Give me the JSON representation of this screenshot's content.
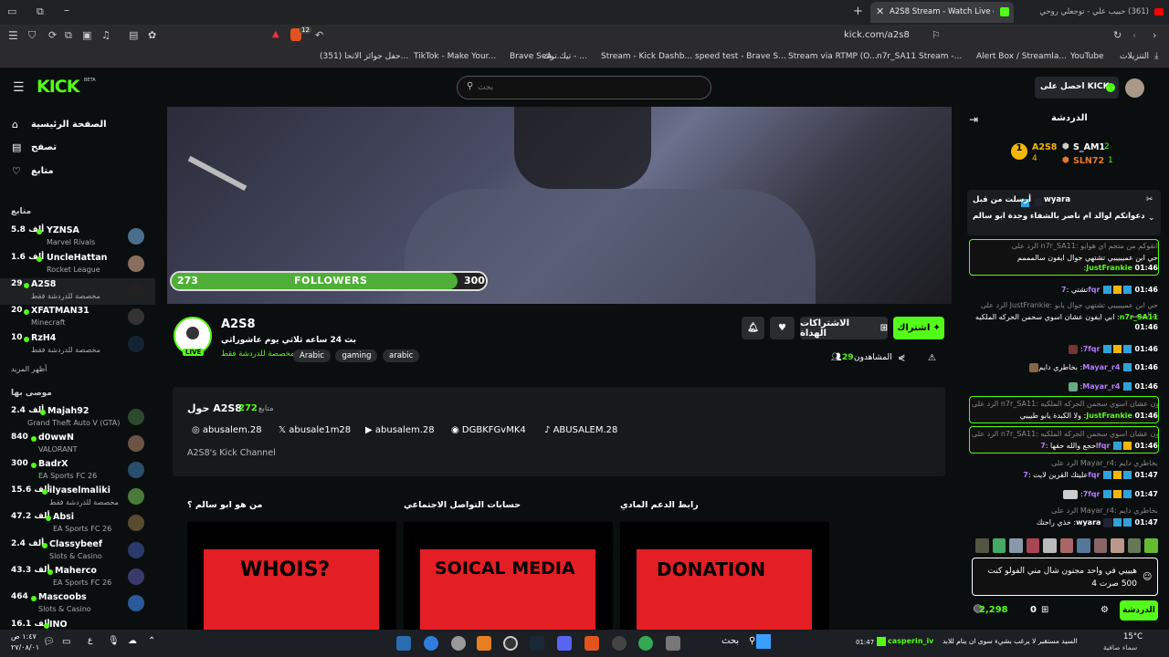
{
  "browser": {
    "tabs": [
      {
        "label": "A2S8 Stream - Watch Live on"
      },
      {
        "label": "(361) حبيب علي - توجعلي روحي"
      }
    ],
    "url": "kick.com/a2s8",
    "shield_count": "12",
    "bookmarks": [
      "التنزيلات",
      "YouTube",
      "Alert Box / Streamla...",
      "n7r_SA11 Stream -...",
      "Stream via RTMP (O...",
      "speed test - Brave S...",
      "Stream - Kick Dashb...",
      "تيك توك - ...",
      "Brave Sea...",
      "TikTok - Make Your...",
      "(351) حفل جوائز الاتحا..."
    ]
  },
  "header": {
    "logo": "KICK",
    "beta": "BETA",
    "search_placeholder": "بحث",
    "get_kicks_label": "احصل على KICKs"
  },
  "sidebar": {
    "nav": [
      {
        "label": "الصفحة الرئيسية",
        "icon": "home-icon"
      },
      {
        "label": "تصفح",
        "icon": "browse-icon"
      },
      {
        "label": "متابع",
        "icon": "heart-icon"
      }
    ],
    "following_title": "متابع",
    "following": [
      {
        "name": "YZNSA",
        "viewers": "5.8 ألف",
        "game": "Marvel Rivals"
      },
      {
        "name": "UncleHattan",
        "viewers": "1.6 ألف",
        "game": "Rocket League"
      },
      {
        "name": "A2S8",
        "viewers": "29",
        "game": "مخصصة للدردشة فقط"
      },
      {
        "name": "XFATMAN31",
        "viewers": "20",
        "game": "Minecraft"
      },
      {
        "name": "RzH4",
        "viewers": "10",
        "game": "مخصصة للدردشة فقط"
      }
    ],
    "show_more": "أظهر المزيد",
    "recommended_title": "موصى بها",
    "recommended": [
      {
        "name": "Majah92",
        "viewers": "2.4 ألف",
        "game": "Grand Theft Auto V (GTA)"
      },
      {
        "name": "d0wwN",
        "viewers": "840",
        "game": "VALORANT"
      },
      {
        "name": "BadrX",
        "viewers": "300",
        "game": "EA Sports FC 26"
      },
      {
        "name": "ilyaselmaliki",
        "viewers": "15.6 ألف",
        "game": "مخصصة للدردشة فقط"
      },
      {
        "name": "Absi",
        "viewers": "47.2 ألف",
        "game": "EA Sports FC 26"
      },
      {
        "name": "Classybeef",
        "viewers": "2.4 ألف",
        "game": "Slots & Casino"
      },
      {
        "name": "Maherco",
        "viewers": "43.3 ألف",
        "game": "EA Sports FC 26"
      },
      {
        "name": "Mascoobs",
        "viewers": "464",
        "game": "Slots & Casino"
      },
      {
        "name": "INO",
        "viewers": "16.1 ألف",
        "game": ""
      }
    ]
  },
  "video": {
    "followers_current": "273",
    "followers_label": "FOLLOWERS",
    "followers_goal": "300",
    "followers_progress": 0.91
  },
  "channel": {
    "name": "A2S8",
    "live_label": "LIVE",
    "title": "بث 24 ساعه ثلاثي يوم عاشوراثي",
    "category": "مخصصة للدردشة فقط",
    "tags": [
      "Arabic",
      "gaming",
      "arabic"
    ],
    "subscribe_label": "اشتراك",
    "gift_label": "الاشتراكات الهداة",
    "viewers_label": "المشاهدون",
    "viewers_count": "29"
  },
  "about": {
    "title": "حول A2S8",
    "followers_count": "272",
    "followers_label": "متابع",
    "socials": [
      {
        "icon": "instagram-icon",
        "label": "abusalem.28"
      },
      {
        "icon": "x-icon",
        "label": "abusale1m28"
      },
      {
        "icon": "youtube-icon",
        "label": "abusalem.28"
      },
      {
        "icon": "discord-icon",
        "label": "DGBKFGvMK4"
      },
      {
        "icon": "tiktok-icon",
        "label": "ABUSALEM.28"
      }
    ],
    "description": "A2S8's Kick Channel"
  },
  "panels": [
    {
      "title": "من هو ابو سالم ؟",
      "art": "WHOIS?"
    },
    {
      "title": "حسابات التواصل الاجتماعي",
      "art": "SOICAL MEDIA"
    },
    {
      "title": "رابط الدعم المادي",
      "art": "DONATION"
    }
  ],
  "chat": {
    "title": "الدردشة",
    "leaderboard": [
      {
        "name": "A2S8",
        "count": "4"
      },
      {
        "name": "S_AM1",
        "count": "2"
      },
      {
        "name": "SLN72",
        "count": "1"
      }
    ],
    "pinned": {
      "by_label": "أرسلت من قبل",
      "user": "wyara",
      "text": "دعواتكم لوالد ام ناصر بالشفاء وجدة ابو سالم"
    },
    "messages": [
      {
        "reply": "الرد على n7r_SA11: انقوكم من متجم اي هوايو",
        "time": "01:46",
        "user": "JustFrankie",
        "text": "حي ابن عميييييي تشتهي جوال ايفون سالمممم",
        "hl": true
      },
      {
        "reply": "",
        "time": "01:46",
        "user": "7fqr",
        "text": "تشتي",
        "hl": false
      },
      {
        "reply": "الرد على JustFrankie: حي ابن عميييييي تشتهي جوال يابو سالمممم",
        "time": "01:46",
        "user": "n7r_SA11",
        "text": "ابي ايفون عشان اسوي سحمن الحركه الملكيه",
        "hl": false
      },
      {
        "reply": "",
        "time": "01:46",
        "user": "7fqr",
        "text": "",
        "hl": false
      },
      {
        "reply": "",
        "time": "01:46",
        "user": "Mayar_r4",
        "text": "بخاطري دايم",
        "hl": false
      },
      {
        "reply": "",
        "time": "01:46",
        "user": "Mayar_r4",
        "text": "",
        "hl": false
      },
      {
        "reply": "الرد على n7r_SA11: ابي ايفون عشان اسوي سحمن الحركه الملكيه",
        "time": "01:46",
        "user": "JustFrankie",
        "text": "ولا الكبدة يابو طيييي",
        "hl": true
      },
      {
        "reply": "الرد على n7r_SA11: ابي ايفون عشان اسوي سحمن الحركه الملكيه",
        "time": "01:46",
        "user": "7fqr",
        "text": "احجع والله حقها",
        "hl": true
      },
      {
        "reply": "الرد على Mayar_r4: بخاطري دايم",
        "time": "01:47",
        "user": "7fqr",
        "text": "عليتك القرين لايت",
        "hl": false
      },
      {
        "reply": "",
        "time": "01:47",
        "user": "7fqr",
        "text": "",
        "hl": false
      },
      {
        "reply": "الرد على Mayar_r4: بخاطري دايم",
        "time": "01:47",
        "user": "wyara",
        "text": "خذي راحتك",
        "hl": false
      }
    ],
    "input_text": "هيييي في واحد مجنون شال مني الفولو كنت 500 صرت 4",
    "points": "2,298",
    "zero": "0",
    "send_label": "الدردشة"
  },
  "taskbar": {
    "weather_temp": "15°C",
    "weather_text": "سماء صافية",
    "news_user": "casperin_iv",
    "news_text": "السيد مستقبر لا يرغب بشيء سوى ان ينام للابد",
    "news_time": "01:47",
    "search_label": "بحث",
    "time": "١:٤٧ ص",
    "date": "٢٧/٠٨/٠١"
  },
  "colors": {
    "kick_green": "#53fc18",
    "background": "#0b0e0f",
    "panel_red": "#e31e24"
  }
}
